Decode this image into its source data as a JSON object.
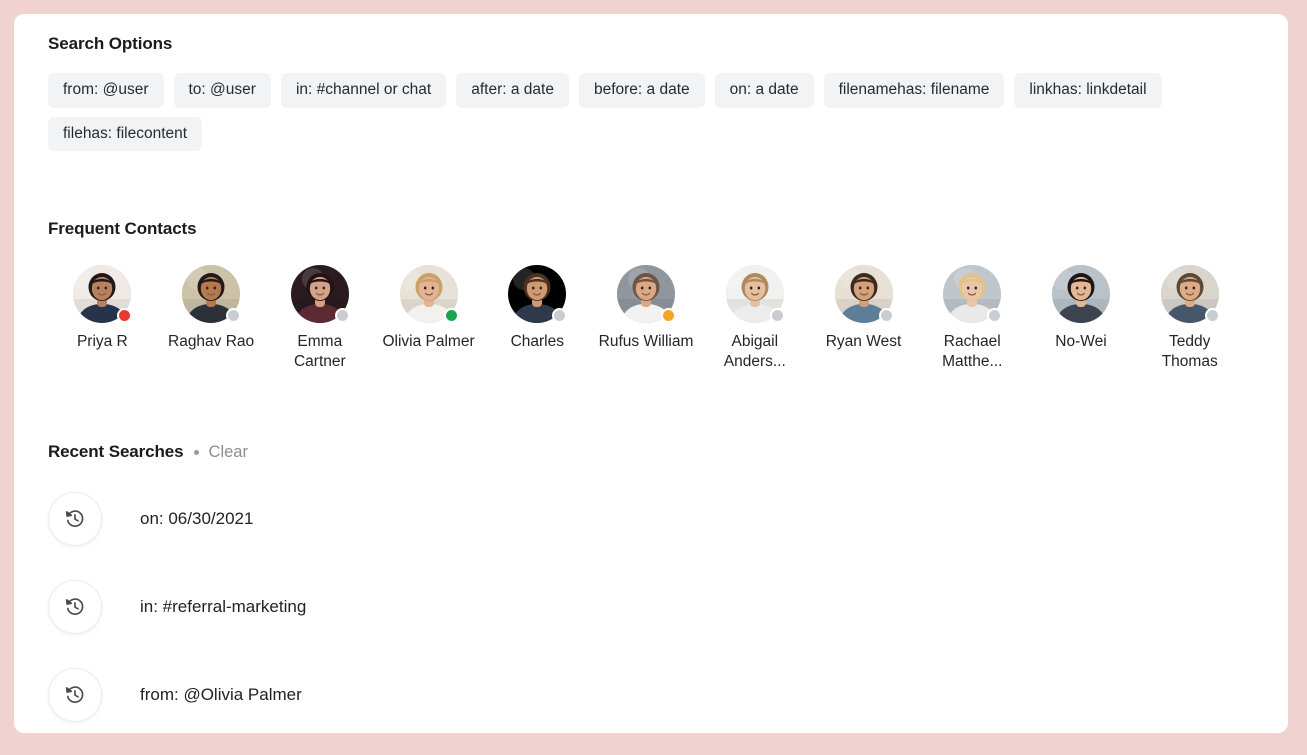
{
  "theme": {
    "page_background": "#f0d2d0",
    "card_background": "#ffffff",
    "chip_background": "#f1f3f5",
    "text_primary": "#1b1b1b",
    "text_muted": "#8e8e8e",
    "status_online": "#1aa74a",
    "status_busy": "#e8382f",
    "status_away": "#f5a524",
    "status_offline": "#c9ccd1"
  },
  "search_options": {
    "title": "Search Options",
    "chips": [
      {
        "label": "from: @user"
      },
      {
        "label": "to: @user"
      },
      {
        "label": "in: #channel or chat"
      },
      {
        "label": "after: a date"
      },
      {
        "label": "before: a date"
      },
      {
        "label": "on: a date"
      },
      {
        "label": "filenamehas: filename"
      },
      {
        "label": "linkhas: linkdetail"
      },
      {
        "label": "filehas: filecontent"
      }
    ]
  },
  "frequent_contacts": {
    "title": "Frequent Contacts",
    "contacts": [
      {
        "name": "Priya R",
        "status": "busy",
        "status_color": "#e8382f",
        "avatar_icon": "avatar-photo",
        "skin": "#b6815d",
        "hair": "#22181a",
        "shirt": "#27334a",
        "bg": "#efeae6"
      },
      {
        "name": "Raghav Rao",
        "status": "offline",
        "status_color": "#c9ccd1",
        "avatar_icon": "avatar-photo",
        "skin": "#b5794f",
        "hair": "#211a16",
        "shirt": "#2c3038",
        "bg": "#cbc2a8"
      },
      {
        "name": "Emma Cartner",
        "status": "offline",
        "status_color": "#c9ccd1",
        "avatar_icon": "avatar-photo",
        "skin": "#d3a184",
        "hair": "#231316",
        "shirt": "#5d2a33",
        "bg": "#2b1b1f"
      },
      {
        "name": "Olivia Palmer",
        "status": "online",
        "status_color": "#1aa74a",
        "avatar_icon": "avatar-photo",
        "skin": "#e2b494",
        "hair": "#caa06a",
        "shirt": "#f3f1ee",
        "bg": "#e8e2d6"
      },
      {
        "name": "Charles",
        "status": "offline",
        "status_color": "#c9ccd1",
        "avatar_icon": "avatar-photo",
        "skin": "#cf9a73",
        "hair": "#4a3122",
        "shirt": "#2e3a4c",
        "bg": "#9a7košt"
      },
      {
        "name": "Rufus William",
        "status": "away",
        "status_color": "#f5a524",
        "avatar_icon": "avatar-photo",
        "skin": "#dca883",
        "hair": "#6d5543",
        "shirt": "#f2f2f3",
        "bg": "#8f969d"
      },
      {
        "name": "Abigail Anders...",
        "status": "offline",
        "status_color": "#c9ccd1",
        "avatar_icon": "avatar-photo",
        "skin": "#e6bfa0",
        "hair": "#b08a5e",
        "shirt": "#ececec",
        "bg": "#f1f1f0"
      },
      {
        "name": "Ryan West",
        "status": "offline",
        "status_color": "#c9ccd1",
        "avatar_icon": "avatar-photo",
        "skin": "#d4a07a",
        "hair": "#3b2a1f",
        "shirt": "#5e7d99",
        "bg": "#e7e0d5"
      },
      {
        "name": "Rachael Matthe...",
        "status": "offline",
        "status_color": "#c9ccd1",
        "avatar_icon": "avatar-photo",
        "skin": "#eac6a8",
        "hair": "#e0c389",
        "shirt": "#e9e9ea",
        "bg": "#bfc6cc"
      },
      {
        "name": "No-Wei",
        "status": "none",
        "status_color": "",
        "avatar_icon": "avatar-photo",
        "skin": "#e3b795",
        "hair": "#1c1715",
        "shirt": "#3c4450",
        "bg": "#b9c2c9"
      },
      {
        "name": "Teddy Thomas",
        "status": "offline",
        "status_color": "#c9ccd1",
        "avatar_icon": "avatar-photo",
        "skin": "#dcab85",
        "hair": "#5d4836",
        "shirt": "#46566b",
        "bg": "#d9d4cc"
      }
    ]
  },
  "recent_searches": {
    "title": "Recent Searches",
    "separator": "•",
    "clear_label": "Clear",
    "items": [
      {
        "label": "on: 06/30/2021",
        "icon": "history-clock-icon"
      },
      {
        "label": "in: #referral-marketing",
        "icon": "history-clock-icon"
      },
      {
        "label": "from: @Olivia Palmer",
        "icon": "history-clock-icon"
      }
    ]
  }
}
